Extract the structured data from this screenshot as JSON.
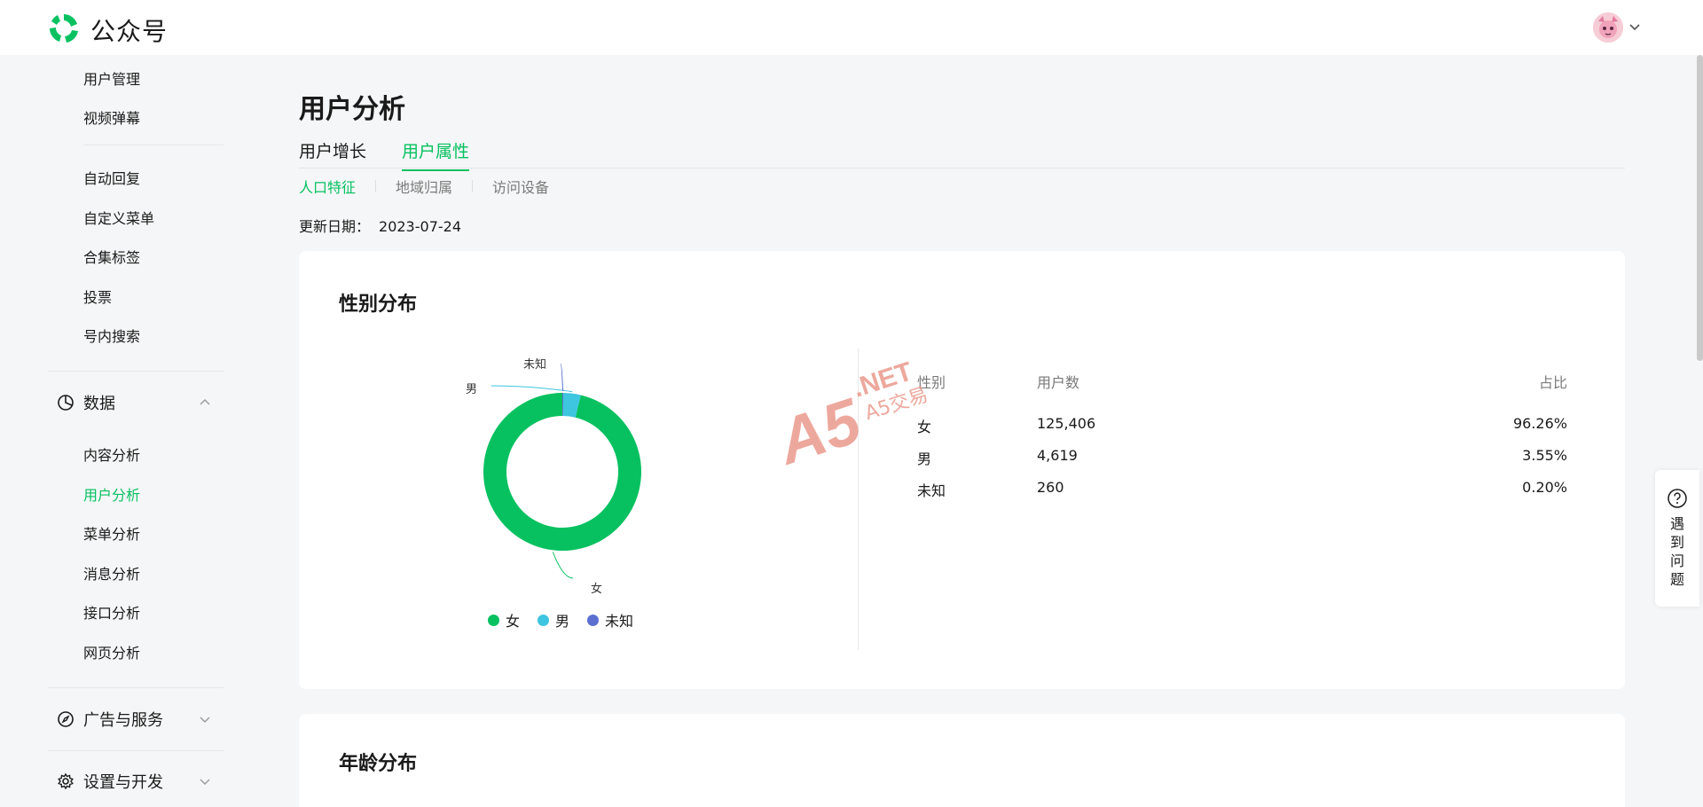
{
  "header": {
    "logo_text": "公众号"
  },
  "sidebar": {
    "items_top": [
      "用户管理",
      "视频弹幕"
    ],
    "items_interact": [
      "自动回复",
      "自定义菜单",
      "合集标签",
      "投票",
      "号内搜索"
    ],
    "group_data": {
      "label": "数据"
    },
    "items_data": [
      "内容分析",
      "用户分析",
      "菜单分析",
      "消息分析",
      "接口分析",
      "网页分析"
    ],
    "active_item": "用户分析",
    "group_ads": {
      "label": "广告与服务"
    },
    "group_settings": {
      "label": "设置与开发"
    }
  },
  "main": {
    "title": "用户分析",
    "tabs": [
      {
        "label": "用户增长"
      },
      {
        "label": "用户属性"
      }
    ],
    "active_tab": "用户属性",
    "subtabs": [
      {
        "label": "人口特征"
      },
      {
        "label": "地域归属"
      },
      {
        "label": "访问设备"
      }
    ],
    "active_subtab": "人口特征",
    "update_label": "更新日期：",
    "update_date": "2023-07-24"
  },
  "gender_card": {
    "title": "性别分布",
    "table_headers": [
      "性别",
      "用户数",
      "占比"
    ],
    "rows": [
      {
        "gender": "女",
        "users": "125,406",
        "percent": "96.26%"
      },
      {
        "gender": "男",
        "users": "4,619",
        "percent": "3.55%"
      },
      {
        "gender": "未知",
        "users": "260",
        "percent": "0.20%"
      }
    ]
  },
  "age_card": {
    "title": "年龄分布"
  },
  "watermark": {
    "line1": "A5",
    "line2": ".NET",
    "line3": "A5交易"
  },
  "help": {
    "label": "遇到问题"
  },
  "colors": {
    "accent": "#07c160",
    "female": "#07c160",
    "male": "#3ec5e0",
    "unknown": "#5b6fd0"
  },
  "chart_data": {
    "type": "pie",
    "subtype": "donut",
    "title": "",
    "categories": [
      "女",
      "男",
      "未知"
    ],
    "values": [
      125406,
      4619,
      260
    ],
    "percent": [
      96.26,
      3.55,
      0.2
    ],
    "colors": [
      "#07c160",
      "#3ec5e0",
      "#5b6fd0"
    ],
    "legend": "bottom"
  }
}
